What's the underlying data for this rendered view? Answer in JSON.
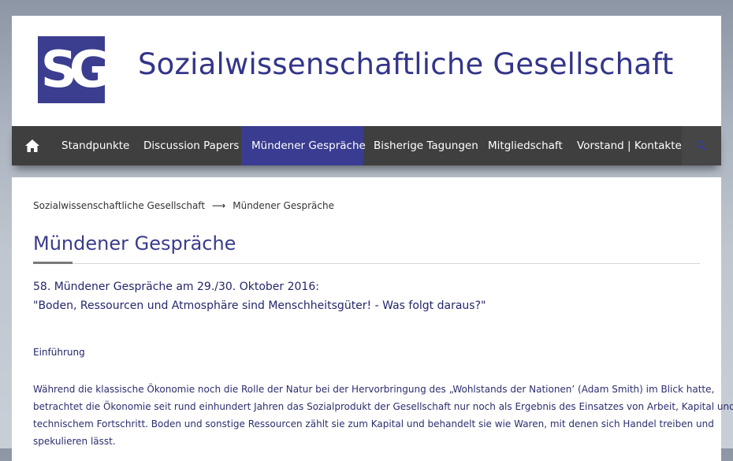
{
  "header": {
    "logo_text": "SG",
    "site_title": "Sozialwissenschaftliche Gesellschaft"
  },
  "nav": {
    "home_icon": "home-icon",
    "items": [
      {
        "label": "Standpunkte",
        "active": false
      },
      {
        "label": "Discussion Papers",
        "active": false
      },
      {
        "label": "Mündener Gespräche",
        "active": true
      },
      {
        "label": "Bisherige Tagungen",
        "active": false
      },
      {
        "label": "Mitgliedschaft",
        "active": false
      },
      {
        "label": "Vorstand | Kontakte",
        "active": false
      }
    ],
    "search_icon": "search-icon"
  },
  "breadcrumb": {
    "home": "Sozialwissenschaftliche Gesellschaft",
    "separator": "⟶",
    "current": "Mündener Gespräche"
  },
  "page": {
    "title": "Mündener Gespräche",
    "subtitle_line1": "58. Mündener Gespräche am 29./30. Oktober 2016:",
    "subtitle_line2": "\"Boden, Ressourcen und Atmosphäre sind Menschheitsgüter! - Was folgt daraus?\"",
    "section_label": "Einführung",
    "paragraph_lines": [
      "Während die klassische Ökonomie noch die Rolle der Natur bei der Hervorbringung des „Wohlstands der Nationen’ (Adam Smith) im Blick hatte,",
      "betrachtet die Ökonomie seit rund einhundert Jahren das Sozialprodukt der Gesellschaft nur noch als Ergebnis des Einsatzes von Arbeit, Kapital und",
      "technischem Fortschritt. Boden und sonstige Ressourcen zählt sie zum Kapital und behandelt sie wie Waren, mit denen sich Handel treiben und",
      "spekulieren lässt."
    ]
  },
  "colors": {
    "brand": "#3b3d8f",
    "nav_bg": "#3f3f3f",
    "nav_active": "#393c90",
    "text_dark_blue": "#24266b"
  }
}
